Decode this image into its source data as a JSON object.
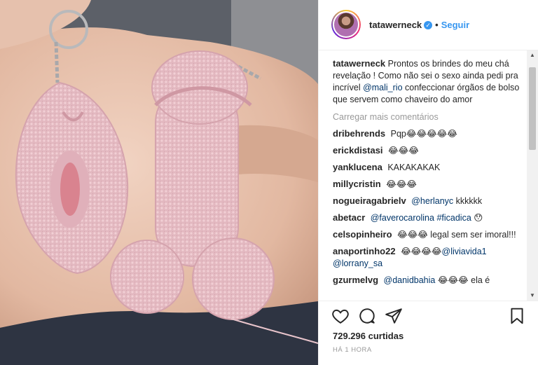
{
  "post": {
    "username": "tatawerneck",
    "follow_label": "Seguir",
    "dot": "•",
    "verified_glyph": "✓"
  },
  "caption": {
    "username": "tatawerneck",
    "text_1": "Prontos os brindes do meu chá revelação ! Como não sei o sexo ainda pedi pra incrível",
    "mention": "@mali_rio",
    "text_2": "confeccionar órgãos de bolso que servem como chaveiro do amor"
  },
  "load_more_label": "Carregar mais comentários",
  "comments": [
    {
      "user": "dribehrends",
      "parts": [
        {
          "t": "Pqp😂😂😂😂😂",
          "link": false
        }
      ]
    },
    {
      "user": "erickdistasi",
      "parts": [
        {
          "t": "😂😂😂",
          "link": false
        }
      ]
    },
    {
      "user": "yanklucena",
      "parts": [
        {
          "t": "KAKAKAKAK",
          "link": false
        }
      ]
    },
    {
      "user": "millycristin",
      "parts": [
        {
          "t": "😂😂😂",
          "link": false
        }
      ]
    },
    {
      "user": "nogueiragabrielv",
      "parts": [
        {
          "t": "@herlanyc",
          "link": true
        },
        {
          "t": " kkkkkk",
          "link": false
        }
      ]
    },
    {
      "user": "abetacr",
      "parts": [
        {
          "t": "@faverocarolina",
          "link": true
        },
        {
          "t": " ",
          "link": false
        },
        {
          "t": "#ficadica",
          "link": true
        },
        {
          "t": " 😯",
          "link": false
        }
      ]
    },
    {
      "user": "celsopinheiro",
      "parts": [
        {
          "t": "😂😂😂 legal sem ser imoral!!!",
          "link": false
        }
      ]
    },
    {
      "user": "anaportinho22",
      "parts": [
        {
          "t": "😂😂😂😂",
          "link": false
        },
        {
          "t": "@liviavida1",
          "link": true
        },
        {
          "t": " ",
          "link": false
        },
        {
          "t": "@lorrany_sa",
          "link": true
        }
      ]
    },
    {
      "user": "gzurmelvg",
      "parts": [
        {
          "t": "@danidbahia",
          "link": true
        },
        {
          "t": " 😂😂😂 ela é",
          "link": false
        }
      ]
    }
  ],
  "likes_text": "729.296 curtidas",
  "time_text": "HÁ 1 HORA",
  "icons": [
    "heart-icon",
    "comment-icon",
    "share-icon",
    "bookmark-icon"
  ],
  "colors": {
    "link": "#003569",
    "follow": "#3897f0",
    "muted": "#999999"
  }
}
